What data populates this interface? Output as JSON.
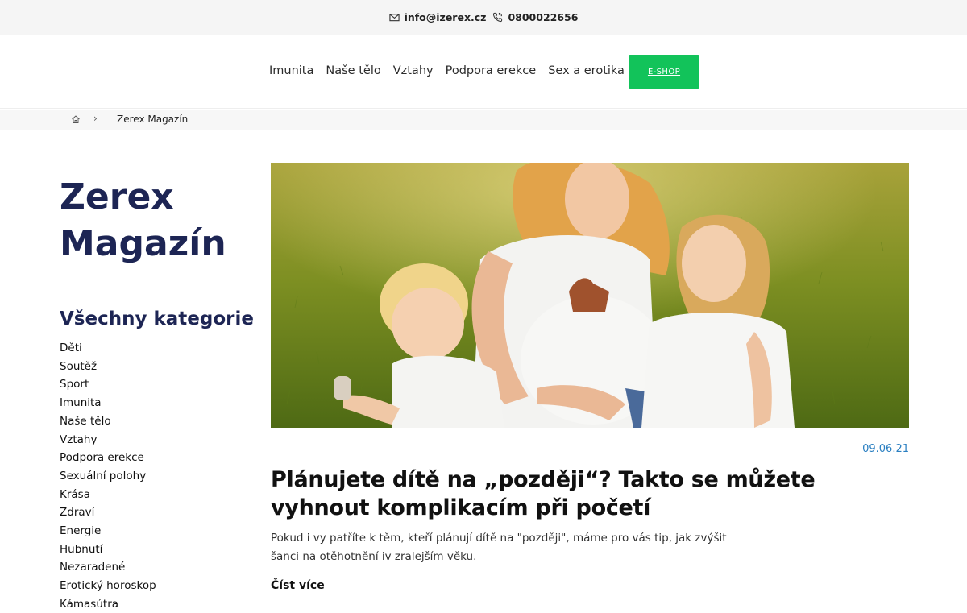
{
  "topbar": {
    "email": "info@izerex.cz",
    "email_icon": "envelope-icon",
    "phone": "0800022656",
    "phone_icon": "phone-icon"
  },
  "nav": {
    "links": [
      "Imunita",
      "Naše tělo",
      "Vztahy",
      "Podpora erekce",
      "Sex a erotika"
    ],
    "eshop_label": "E-SHOP"
  },
  "colors": {
    "brand_navy": "#1d2554",
    "eshop_green": "#12c35a",
    "date_blue": "#2a7fc1"
  },
  "breadcrumb": {
    "home_icon": "home-icon",
    "separator_icon": "chevron-right-icon",
    "current": "Zerex Magazín"
  },
  "sidebar": {
    "title": "Zerex Magazín",
    "categories_heading": "Všechny kategorie",
    "categories": [
      "Děti",
      "Soutěž",
      "Sport",
      "Imunita",
      "Naše tělo",
      "Vztahy",
      "Podpora erekce",
      "Sexuální polohy",
      "Krása",
      "Zdraví",
      "Energie",
      "Hubnutí",
      "Nezaradené",
      "Erotický horoskop",
      "Kámasútra"
    ]
  },
  "article": {
    "date": "09.06.21",
    "title": "Plánujete dítě na „později“? Takto se můžete vyhnout komplikacím při početí",
    "excerpt": "Pokud i vy patříte k těm, kteří plánují dítě na \"později\", máme pro vás tip, jak zvýšit šanci na otěhotnění iv zralejším věku.",
    "read_more": "Číst více"
  }
}
